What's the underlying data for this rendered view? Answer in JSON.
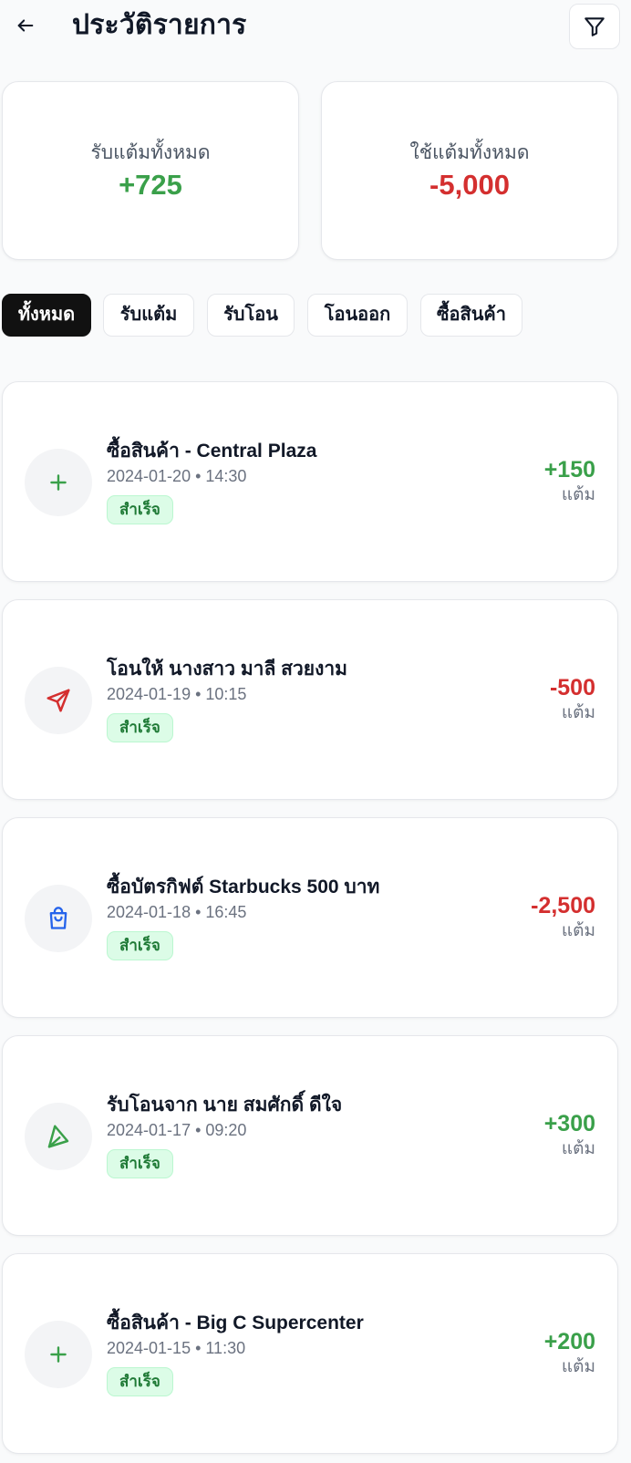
{
  "header": {
    "title": "ประวัติรายการ",
    "back_icon": "arrow-left-icon",
    "filter_icon": "filter-icon"
  },
  "summary": {
    "earned_label": "รับแต้มทั้งหมด",
    "earned_value": "+725",
    "spent_label": "ใช้แต้มทั้งหมด",
    "spent_value": "-5,000"
  },
  "tabs": [
    {
      "label": "ทั้งหมด",
      "active": true
    },
    {
      "label": "รับแต้ม",
      "active": false
    },
    {
      "label": "รับโอน",
      "active": false
    },
    {
      "label": "โอนออก",
      "active": false
    },
    {
      "label": "ซื้อสินค้า",
      "active": false
    }
  ],
  "transactions": [
    {
      "title": "ซื้อสินค้า - Central Plaza",
      "datetime": "2024-01-20 • 14:30",
      "status": "สำเร็จ",
      "amount": "+150",
      "unit": "แต้ม",
      "icon": "plus-icon",
      "direction": "in"
    },
    {
      "title": "โอนให้ นางสาว มาลี สวยงาม",
      "datetime": "2024-01-19 • 10:15",
      "status": "สำเร็จ",
      "amount": "-500",
      "unit": "แต้ม",
      "icon": "send-icon",
      "direction": "out"
    },
    {
      "title": "ซื้อบัตรกิฟต์ Starbucks 500 บาท",
      "datetime": "2024-01-18 • 16:45",
      "status": "สำเร็จ",
      "amount": "-2,500",
      "unit": "แต้ม",
      "icon": "shopping-bag-icon",
      "direction": "out"
    },
    {
      "title": "รับโอนจาก นาย สมศักดิ์ ดีใจ",
      "datetime": "2024-01-17 • 09:20",
      "status": "สำเร็จ",
      "amount": "+300",
      "unit": "แต้ม",
      "icon": "receive-icon",
      "direction": "in"
    },
    {
      "title": "ซื้อสินค้า - Big C Supercenter",
      "datetime": "2024-01-15 • 11:30",
      "status": "สำเร็จ",
      "amount": "+200",
      "unit": "แต้ม",
      "icon": "plus-icon",
      "direction": "in"
    }
  ],
  "colors": {
    "positive": "#3aa04a",
    "negative": "#d42f2f",
    "active_tab": "#111111"
  }
}
